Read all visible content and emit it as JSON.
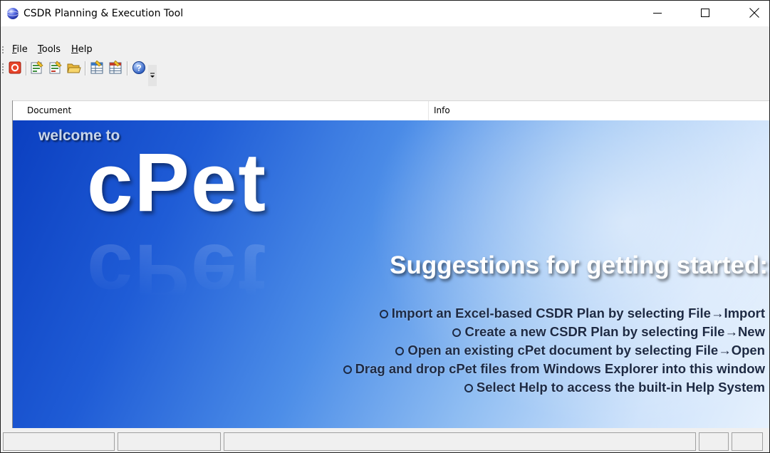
{
  "window": {
    "title": "CSDR Planning & Execution Tool",
    "app_icon": "blue-globe-icon"
  },
  "caption_buttons": [
    "minimize-icon",
    "maximize-icon",
    "close-icon"
  ],
  "menu": {
    "items": [
      {
        "mnemonic": "F",
        "rest": "ile"
      },
      {
        "mnemonic": "T",
        "rest": "ools"
      },
      {
        "mnemonic": "H",
        "rest": "elp"
      }
    ]
  },
  "toolbar": {
    "buttons": [
      "stop-icon",
      "new-plan-icon",
      "new-plan-alt-icon",
      "open-folder-icon",
      "import-table-icon",
      "export-table-icon",
      "help-icon",
      "toolbar-overflow-icon"
    ]
  },
  "columns": {
    "document": "Document",
    "info": "Info"
  },
  "welcome": {
    "welcome_to": "welcome to",
    "logo": "cPet",
    "heading": "Suggestions for getting started:",
    "suggestions": [
      "Import an Excel-based CSDR Plan by selecting File→Import",
      "Create a new CSDR Plan by selecting File→New",
      "Open an existing cPet document by selecting File→Open",
      "Drag and drop cPet files from Windows Explorer into this window",
      "Select Help to access the built-in Help System"
    ]
  },
  "colors": {
    "banner_dark": "#0b3fc0",
    "banner_light": "#e6f1fd",
    "suggestion_text": "#1d2a44"
  }
}
